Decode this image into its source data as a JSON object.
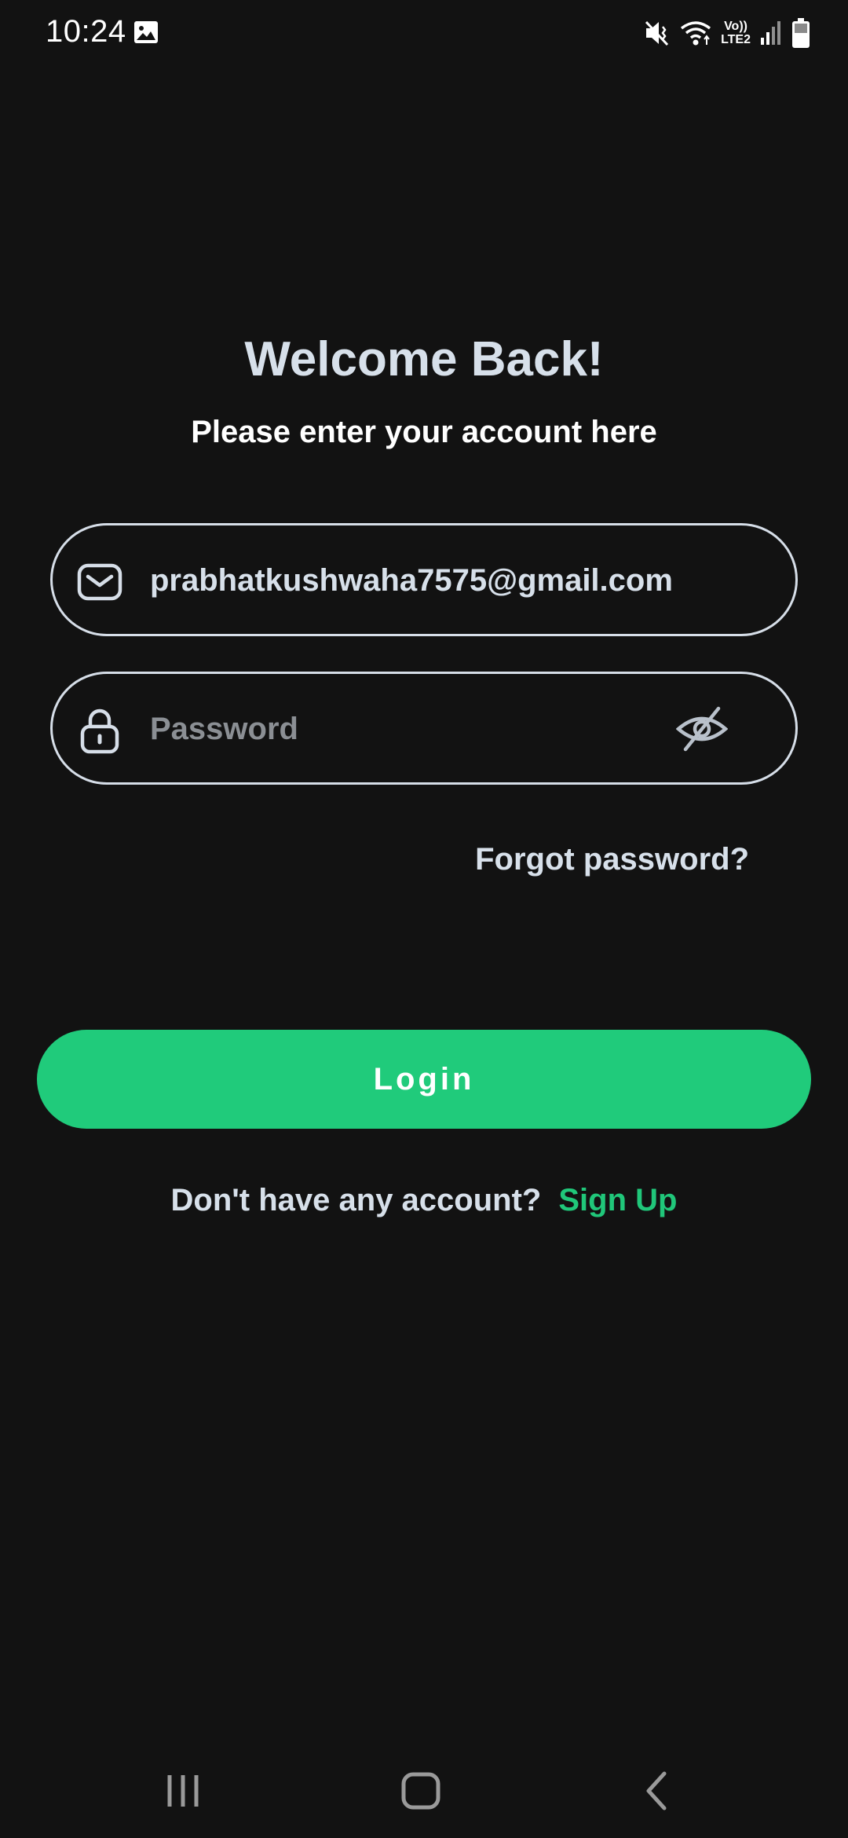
{
  "status_bar": {
    "time": "10:24",
    "network_label_top": "Vo))",
    "network_label_bottom": "LTE2",
    "icons": [
      "gallery-icon",
      "mute-icon",
      "wifi-icon",
      "signal-icon",
      "battery-icon"
    ]
  },
  "login": {
    "title": "Welcome Back!",
    "subtitle": "Please enter your account here",
    "email_value": "prabhatkushwaha7575@gmail.com",
    "password_placeholder": "Password",
    "forgot_label": "Forgot password?",
    "login_label": "Login",
    "signup_prompt": "Don't have any account?",
    "signup_link": "Sign Up"
  },
  "colors": {
    "background": "#121212",
    "accent": "#20cb7b",
    "text": "#d7e0ea",
    "placeholder": "#8b8f94"
  },
  "navigation": {
    "icons": [
      "recent-apps-icon",
      "home-icon",
      "back-icon"
    ]
  }
}
